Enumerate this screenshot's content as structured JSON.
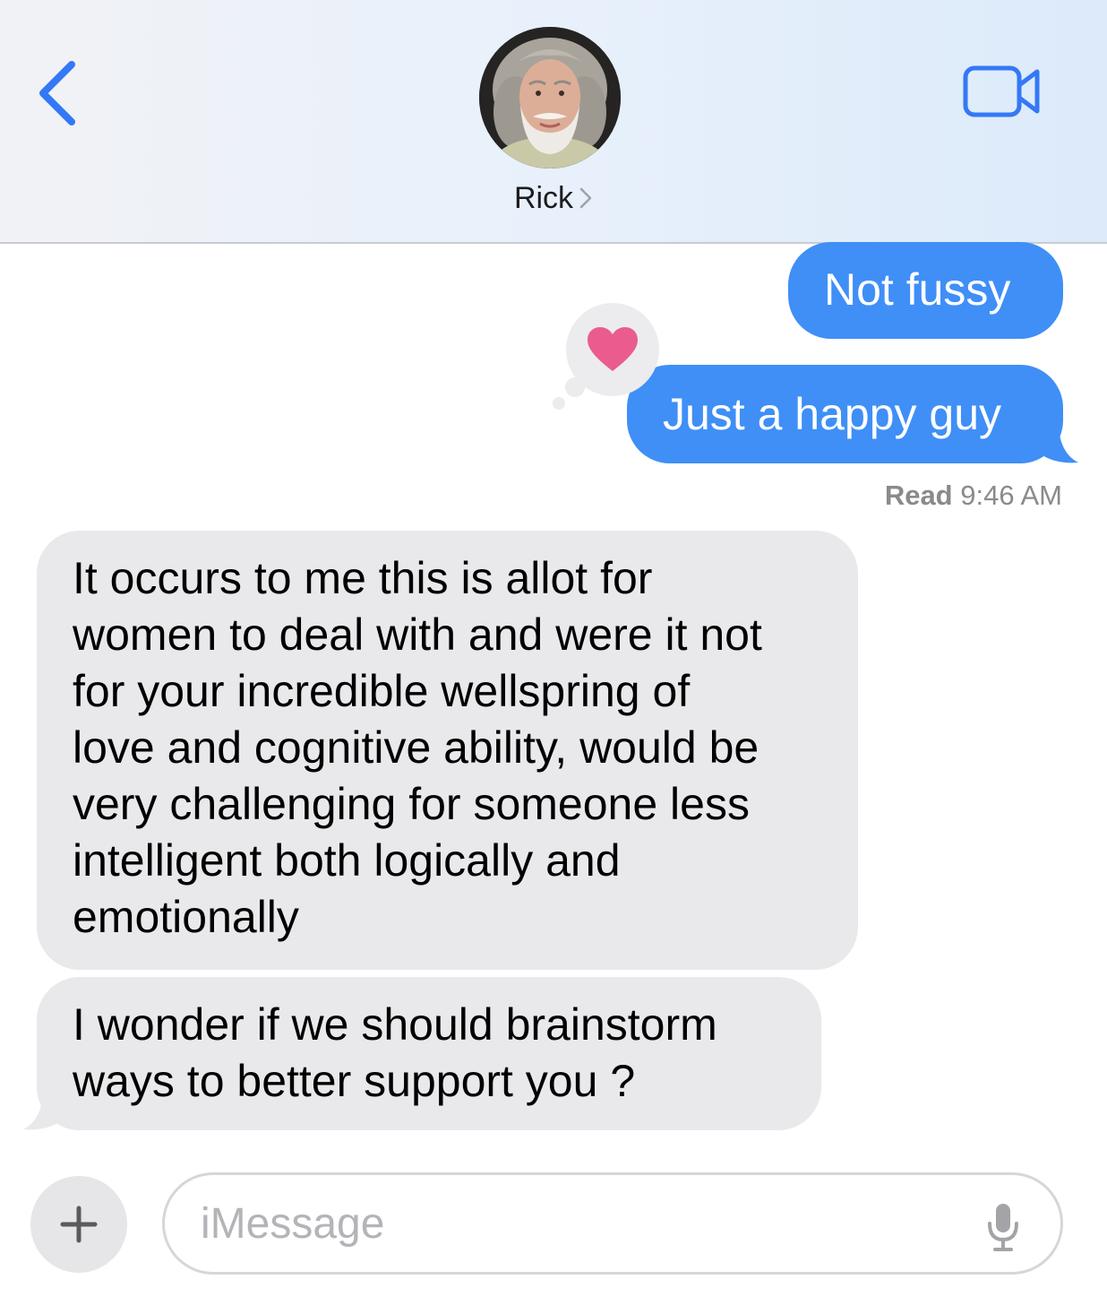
{
  "header": {
    "contact_name": "Rick",
    "back_icon": "chevron-left-icon",
    "video_icon": "video-camera-icon",
    "accent": "#3478f6"
  },
  "messages": [
    {
      "direction": "sent",
      "text": "Not fussy"
    },
    {
      "direction": "sent",
      "text": "Just a happy guy",
      "tapback": "heart"
    },
    {
      "direction": "received",
      "text": "It occurs to me this is allot for\nwomen to deal with and were it not\nfor your incredible wellspring of\nlove and cognitive ability, would be\nvery challenging for someone less\nintelligent both logically and\nemotionally"
    },
    {
      "direction": "received",
      "text": "I wonder if we should brainstorm\nways to better support you ?"
    }
  ],
  "read_receipt": {
    "label": "Read",
    "time": "9:46 AM"
  },
  "composer": {
    "placeholder": "iMessage",
    "plus_icon": "plus-icon",
    "mic_icon": "microphone-icon"
  },
  "colors": {
    "sent_bubble": "#3f8ff7",
    "received_bubble": "#e9e9eb",
    "tapback_heart": "#ea5c8e"
  }
}
